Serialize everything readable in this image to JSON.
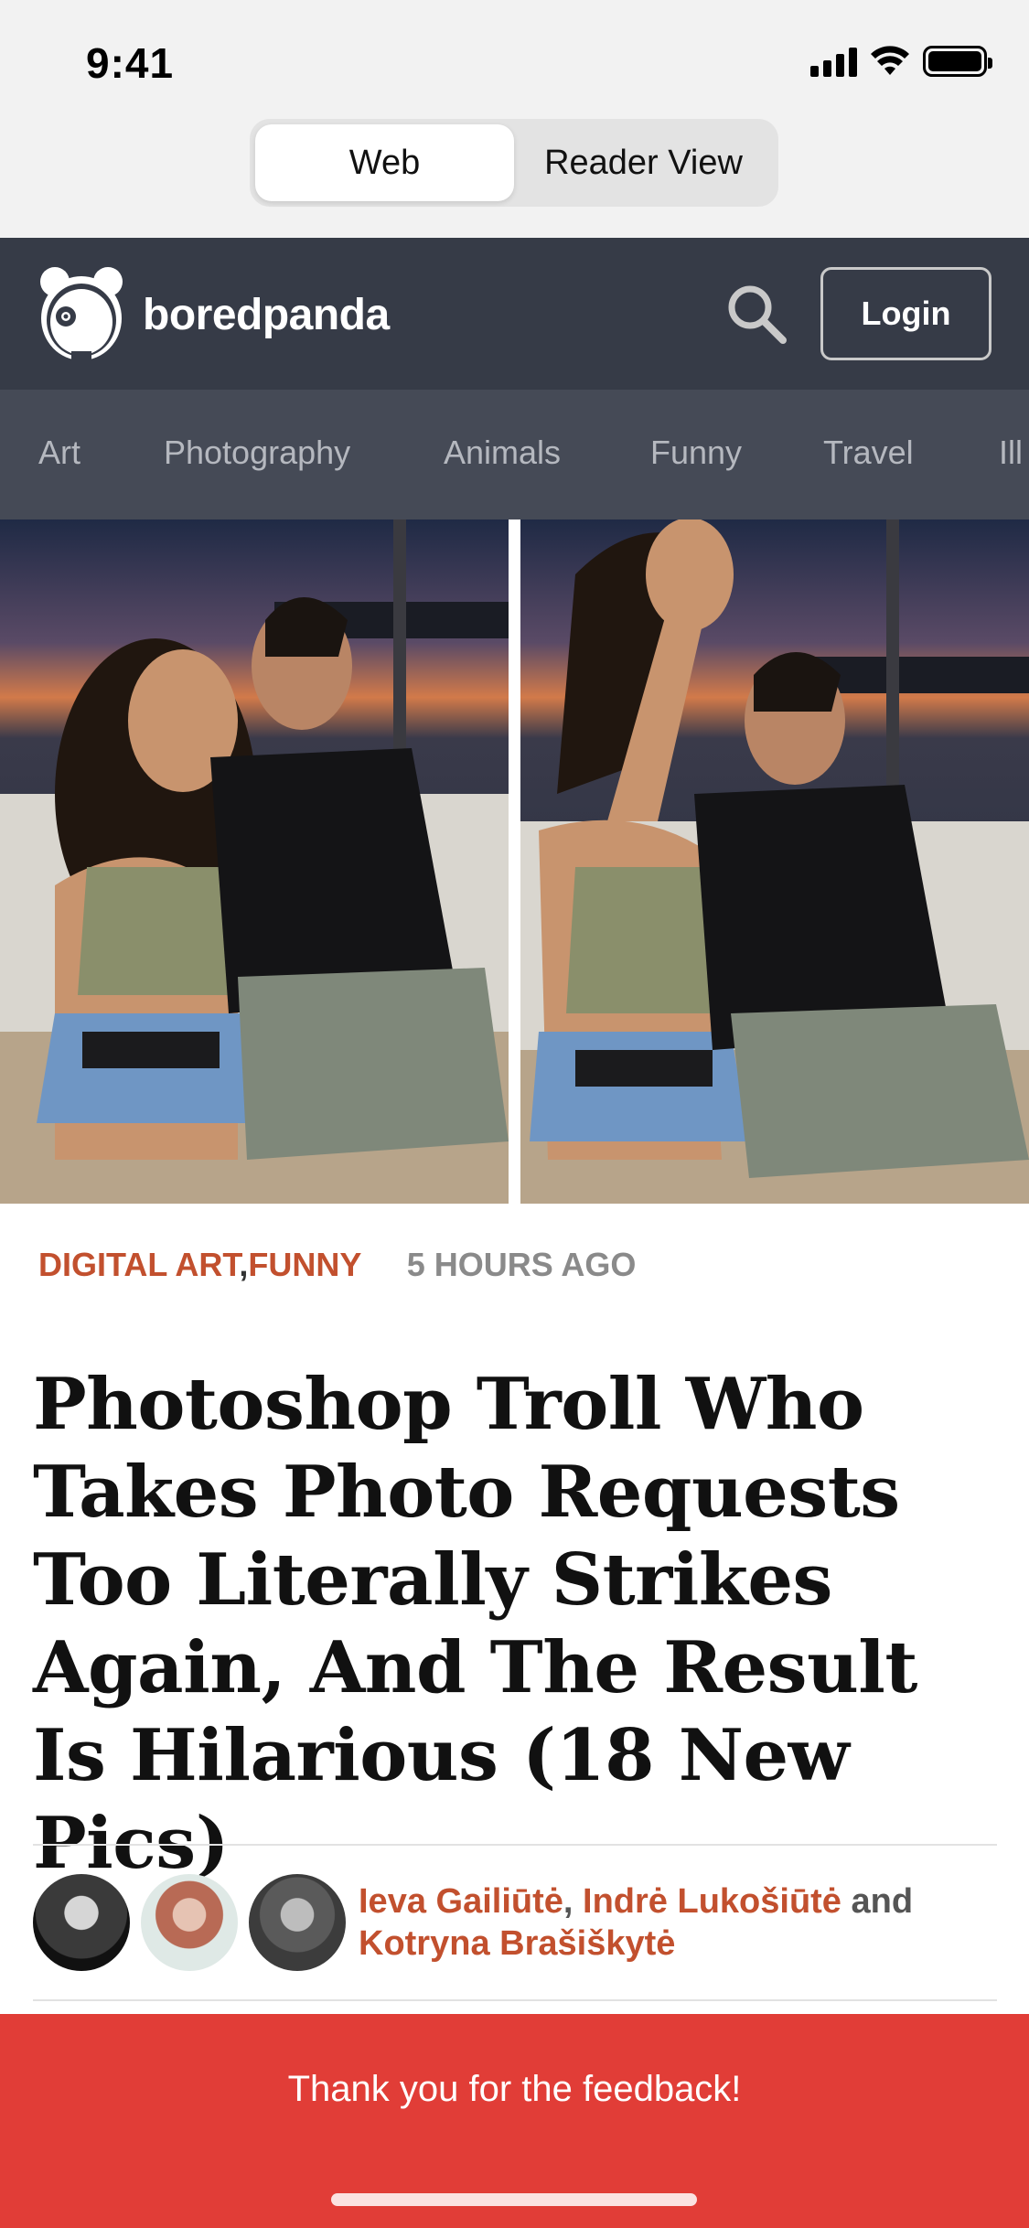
{
  "status_bar": {
    "time": "9:41"
  },
  "view_toggle": {
    "web": "Web",
    "reader": "Reader View",
    "selected": "Web"
  },
  "header": {
    "brand": "boredpanda",
    "login": "Login"
  },
  "categories": [
    "Art",
    "Photography",
    "Animals",
    "Funny",
    "Travel",
    "Ill"
  ],
  "article": {
    "tags": [
      "DIGITAL ART",
      "FUNNY"
    ],
    "posted": "5 HOURS AGO",
    "headline": "Photoshop Troll Who Takes Photo Requests Too Literally Strikes Again, And The Result Is Hilarious (18 New Pics)",
    "authors": [
      "Ieva Gailiūtė",
      "Indrė Lukošiūtė",
      "Kotryna Brašiškytė"
    ],
    "authors_separator": ",",
    "authors_conjunction": "and"
  },
  "toast": {
    "message": "Thank you for the feedback!"
  },
  "colors": {
    "accent": "#c2502e",
    "header_bg": "#363b47",
    "nav_bg": "#454a56",
    "toast_bg": "#e13d37"
  },
  "icons": [
    "signal-icon",
    "wifi-icon",
    "battery-icon",
    "panda-logo-icon",
    "search-icon"
  ]
}
